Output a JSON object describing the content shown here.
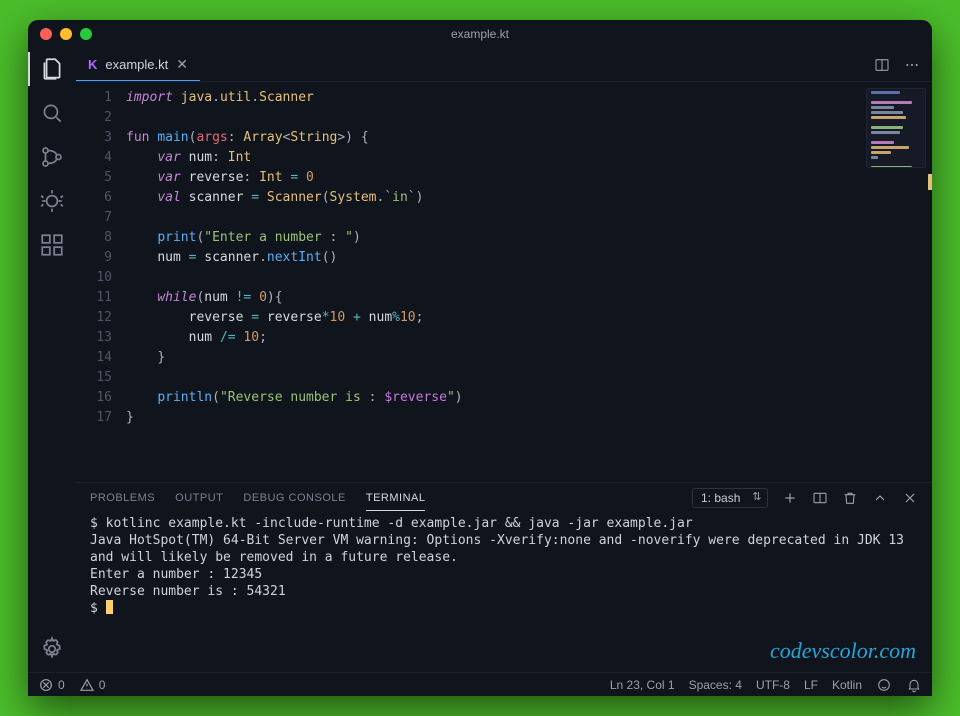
{
  "titlebar": {
    "title": "example.kt"
  },
  "tab": {
    "filename": "example.kt"
  },
  "code": {
    "lines": [
      [
        [
          "kw",
          "import"
        ],
        [
          "pl",
          " "
        ],
        [
          "ty",
          "java"
        ],
        [
          "pn",
          "."
        ],
        [
          "ty",
          "util"
        ],
        [
          "pn",
          "."
        ],
        [
          "ty",
          "Scanner"
        ]
      ],
      [],
      [
        [
          "kw2",
          "fun"
        ],
        [
          "pl",
          " "
        ],
        [
          "fn",
          "main"
        ],
        [
          "pn",
          "("
        ],
        [
          "va",
          "args"
        ],
        [
          "pn",
          ": "
        ],
        [
          "ty",
          "Array"
        ],
        [
          "pn",
          "<"
        ],
        [
          "ty2",
          "String"
        ],
        [
          "pn",
          ">)"
        ],
        [
          "pl",
          " "
        ],
        [
          "pn",
          "{"
        ]
      ],
      [
        [
          "pl",
          "    "
        ],
        [
          "kw",
          "var"
        ],
        [
          "pl",
          " "
        ],
        [
          "pl",
          "num"
        ],
        [
          "pn",
          ": "
        ],
        [
          "ty",
          "Int"
        ]
      ],
      [
        [
          "pl",
          "    "
        ],
        [
          "kw",
          "var"
        ],
        [
          "pl",
          " "
        ],
        [
          "pl",
          "reverse"
        ],
        [
          "pn",
          ": "
        ],
        [
          "ty",
          "Int"
        ],
        [
          "pl",
          " "
        ],
        [
          "op",
          "="
        ],
        [
          "pl",
          " "
        ],
        [
          "num",
          "0"
        ]
      ],
      [
        [
          "pl",
          "    "
        ],
        [
          "kw",
          "val"
        ],
        [
          "pl",
          " "
        ],
        [
          "pl",
          "scanner"
        ],
        [
          "pl",
          " "
        ],
        [
          "op",
          "="
        ],
        [
          "pl",
          " "
        ],
        [
          "ty",
          "Scanner"
        ],
        [
          "pn",
          "("
        ],
        [
          "ty",
          "System"
        ],
        [
          "pn",
          "."
        ],
        [
          "str",
          "`in`"
        ],
        [
          "pn",
          ")"
        ]
      ],
      [],
      [
        [
          "pl",
          "    "
        ],
        [
          "fn",
          "print"
        ],
        [
          "pn",
          "("
        ],
        [
          "str",
          "\"Enter a number : \""
        ],
        [
          "pn",
          ")"
        ]
      ],
      [
        [
          "pl",
          "    "
        ],
        [
          "pl",
          "num"
        ],
        [
          "pl",
          " "
        ],
        [
          "op",
          "="
        ],
        [
          "pl",
          " "
        ],
        [
          "pl",
          "scanner"
        ],
        [
          "pn",
          "."
        ],
        [
          "fn",
          "nextInt"
        ],
        [
          "pn",
          "()"
        ]
      ],
      [],
      [
        [
          "pl",
          "    "
        ],
        [
          "kw",
          "while"
        ],
        [
          "pn",
          "("
        ],
        [
          "pl",
          "num"
        ],
        [
          "pl",
          " "
        ],
        [
          "op",
          "!="
        ],
        [
          "pl",
          " "
        ],
        [
          "num",
          "0"
        ],
        [
          "pn",
          "){"
        ]
      ],
      [
        [
          "pl",
          "        "
        ],
        [
          "pl",
          "reverse"
        ],
        [
          "pl",
          " "
        ],
        [
          "op",
          "="
        ],
        [
          "pl",
          " "
        ],
        [
          "pl",
          "reverse"
        ],
        [
          "op",
          "*"
        ],
        [
          "num",
          "10"
        ],
        [
          "pl",
          " "
        ],
        [
          "op",
          "+"
        ],
        [
          "pl",
          " "
        ],
        [
          "pl",
          "num"
        ],
        [
          "op",
          "%"
        ],
        [
          "num",
          "10"
        ],
        [
          "pn",
          ";"
        ]
      ],
      [
        [
          "pl",
          "        "
        ],
        [
          "pl",
          "num"
        ],
        [
          "pl",
          " "
        ],
        [
          "op",
          "/="
        ],
        [
          "pl",
          " "
        ],
        [
          "num",
          "10"
        ],
        [
          "pn",
          ";"
        ]
      ],
      [
        [
          "pl",
          "    "
        ],
        [
          "pn",
          "}"
        ]
      ],
      [],
      [
        [
          "pl",
          "    "
        ],
        [
          "fn",
          "println"
        ],
        [
          "pn",
          "("
        ],
        [
          "str",
          "\"Reverse number is : "
        ],
        [
          "id",
          "$reverse"
        ],
        [
          "str",
          "\""
        ],
        [
          "pn",
          ")"
        ]
      ],
      [
        [
          "pn",
          "}"
        ]
      ]
    ]
  },
  "panel": {
    "tabs": {
      "problems": "PROBLEMS",
      "output": "OUTPUT",
      "debug": "DEBUG CONSOLE",
      "terminal": "TERMINAL"
    },
    "terminal_select": "1: bash"
  },
  "terminal": {
    "lines": [
      "$ kotlinc example.kt -include-runtime -d example.jar && java -jar example.jar",
      "Java HotSpot(TM) 64-Bit Server VM warning: Options -Xverify:none and -noverify were deprecated in JDK 13 and will likely be removed in a future release.",
      "Enter a number : 12345",
      "Reverse number is : 54321",
      "$ "
    ]
  },
  "watermark": "codevscolor.com",
  "statusbar": {
    "errors": "0",
    "warnings": "0",
    "lncol": "Ln 23, Col 1",
    "spaces": "Spaces: 4",
    "encoding": "UTF-8",
    "eol": "LF",
    "language": "Kotlin"
  }
}
